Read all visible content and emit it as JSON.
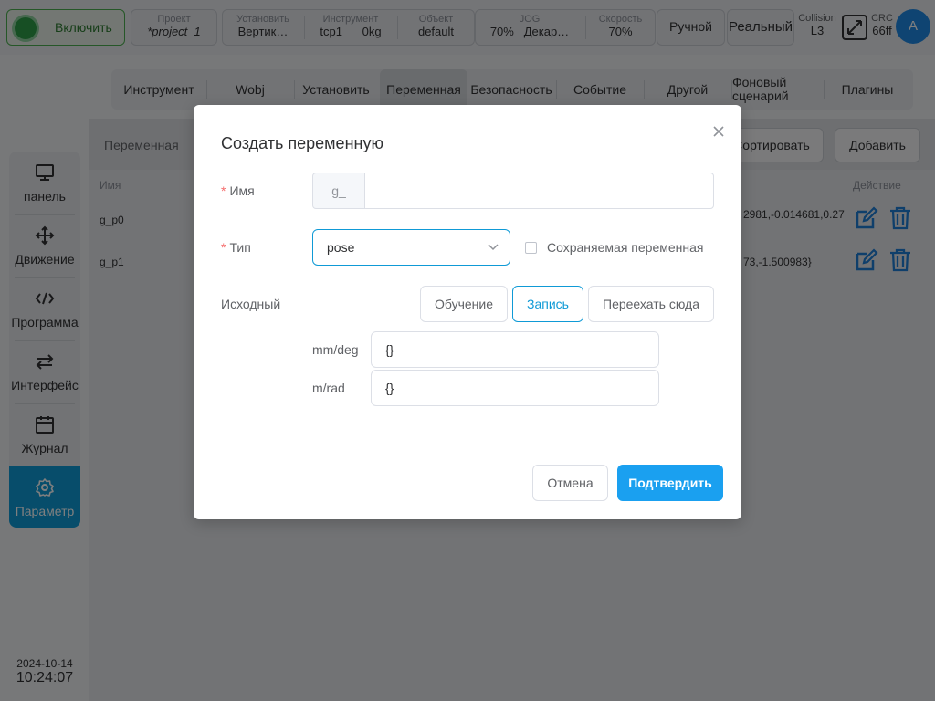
{
  "topbar": {
    "enable_label": "Включить",
    "project": {
      "label": "Проект",
      "value": "*project_1"
    },
    "install": {
      "label": "Установить",
      "value": "Вертик…"
    },
    "tool": {
      "label": "Инструмент",
      "value": "tcp1",
      "load": "0kg"
    },
    "object": {
      "label": "Объект",
      "value": "default"
    },
    "jog": {
      "label": "JOG",
      "speed": "70%",
      "frame": "Декар…"
    },
    "speed": {
      "label": "Скорость",
      "value": "70%"
    },
    "mode_label": "Ручной",
    "real_label": "Реальный",
    "collision": {
      "label": "Collision",
      "value": "L3"
    },
    "crc": {
      "label": "CRC",
      "value": "66ff"
    },
    "avatar": "A"
  },
  "tabs": [
    "Инструмент",
    "Wobj",
    "Установить",
    "Переменная",
    "Безопасность",
    "Событие",
    "Другой",
    "Фоновый сценарий",
    "Плагины"
  ],
  "active_tab": "Переменная",
  "content": {
    "section_title": "Переменная",
    "sort_label": "Сортировать",
    "add_label": "Добавить",
    "col_name": "Имя",
    "col_action": "Действие",
    "rows": [
      {
        "name": "g_p0",
        "value": "2981,-0.014681,0.27"
      },
      {
        "name": "g_p1",
        "value": "73,-1.500983}"
      }
    ]
  },
  "sidebar": {
    "items": [
      "панель",
      "Движение",
      "Программа",
      "Интерфейс",
      "Журнал",
      "Параметр"
    ],
    "active": "Параметр",
    "date": "2024-10-14",
    "time": "10:24:07"
  },
  "dialog": {
    "title": "Создать переменную",
    "name_label": "Имя",
    "name_prefix": "g_",
    "name_value": "",
    "type_label": "Тип",
    "type_value": "pose",
    "persist_label": "Сохраняемая переменная",
    "source_label": "Исходный",
    "btn_teach": "Обучение",
    "btn_record": "Запись",
    "btn_move_here": "Переехать сюда",
    "unit1_label": "mm/deg",
    "unit1_value": "{}",
    "unit2_label": "m/rad",
    "unit2_value": "{}",
    "cancel_label": "Отмена",
    "confirm_label": "Подтвердить"
  },
  "colors": {
    "accent": "#0f9ad6",
    "confirm": "#1aa0f0",
    "enable": "#2e9e48",
    "required": "#f56c6c"
  }
}
